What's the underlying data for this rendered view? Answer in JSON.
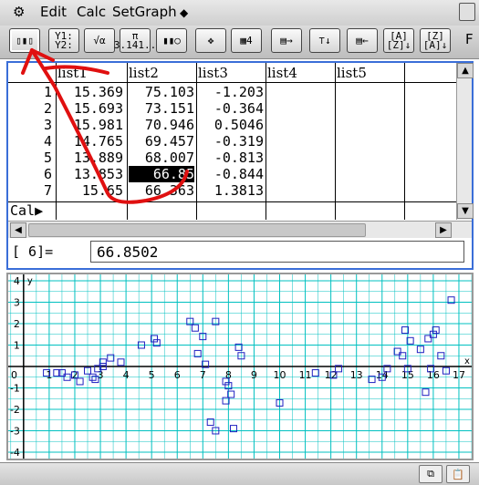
{
  "menubar": {
    "gear_icon": "gear-icon",
    "items": [
      "Edit",
      "Calc",
      "SetGraph"
    ],
    "dropdown_glyph": "◆"
  },
  "toolbar": {
    "buttons": [
      {
        "icon": "stat-graph-icon",
        "glyph": "▯▮▯"
      },
      {
        "icon": "graph-functions-icon",
        "glyph": "Y1:\nY2:"
      },
      {
        "icon": "sqrt-alpha-icon",
        "glyph": "√α"
      },
      {
        "icon": "pi-icon",
        "glyph": "π\n3.141.."
      },
      {
        "icon": "bar-chart-settings-icon",
        "glyph": "▮▮○"
      },
      {
        "icon": "zoom-arrows-icon",
        "glyph": "✥"
      },
      {
        "icon": "list-editor-icon",
        "glyph": "▦4"
      },
      {
        "icon": "insert-column-icon",
        "glyph": "▤→"
      },
      {
        "icon": "sort-icon",
        "glyph": "⊤↓"
      },
      {
        "icon": "delete-column-icon",
        "glyph": "▤←"
      },
      {
        "icon": "sort-ascending-icon",
        "glyph": "[A]\n[Z]↓"
      },
      {
        "icon": "sort-descending-icon",
        "glyph": "[Z]\n[A]↓"
      }
    ],
    "overflow_label": "F"
  },
  "list_editor": {
    "columns": [
      "list1",
      "list2",
      "list3",
      "list4",
      "list5"
    ],
    "rows": [
      {
        "n": "1",
        "list1": "15.369",
        "list2": "75.103",
        "list3": "-1.203"
      },
      {
        "n": "2",
        "list1": "15.693",
        "list2": "73.151",
        "list3": "-0.364"
      },
      {
        "n": "3",
        "list1": "15.981",
        "list2": "70.946",
        "list3": "0.5046"
      },
      {
        "n": "4",
        "list1": "14.765",
        "list2": "69.457",
        "list3": "-0.319"
      },
      {
        "n": "5",
        "list1": "13.889",
        "list2": "68.007",
        "list3": "-0.813"
      },
      {
        "n": "6",
        "list1": "13.853",
        "list2": "66.85",
        "list3": "-0.844"
      },
      {
        "n": "7",
        "list1": "15.65",
        "list2": "66.363",
        "list3": "1.3813"
      }
    ],
    "cal_label": "Cal▶",
    "selected_row": 6,
    "selected_column": "list2"
  },
  "edit_line": {
    "label": "[  6]=",
    "value": "66.8502"
  },
  "graph": {
    "y_axis_label": "y",
    "x_axis_label": "x",
    "origin_label": "0",
    "x_ticks": [
      "1",
      "2",
      "3",
      "4",
      "5",
      "6",
      "7",
      "8",
      "9",
      "10",
      "11",
      "12",
      "13",
      "14",
      "15",
      "16",
      "17"
    ],
    "y_ticks": [
      "4",
      "3",
      "2",
      "1",
      "-1",
      "-2",
      "-3",
      "-4"
    ],
    "grid_color": "#00c0c0",
    "point_color": "#2020c0"
  },
  "chart_data": {
    "type": "scatter",
    "xlim": [
      -0.6,
      17.5
    ],
    "ylim": [
      -4.3,
      4.3
    ],
    "points": [
      [
        0.9,
        -0.3
      ],
      [
        1.3,
        -0.3
      ],
      [
        1.7,
        -0.5
      ],
      [
        2.0,
        -0.4
      ],
      [
        2.2,
        -0.7
      ],
      [
        1.5,
        -0.3
      ],
      [
        2.5,
        -0.2
      ],
      [
        2.7,
        -0.5
      ],
      [
        2.8,
        -0.6
      ],
      [
        2.9,
        -0.1
      ],
      [
        3.1,
        0.2
      ],
      [
        3.1,
        -0.0
      ],
      [
        3.4,
        0.4
      ],
      [
        3.8,
        0.2
      ],
      [
        4.6,
        1.0
      ],
      [
        5.1,
        1.3
      ],
      [
        5.2,
        1.1
      ],
      [
        6.5,
        2.1
      ],
      [
        6.7,
        1.8
      ],
      [
        6.8,
        0.6
      ],
      [
        7.0,
        1.4
      ],
      [
        7.1,
        0.1
      ],
      [
        7.5,
        2.1
      ],
      [
        7.9,
        -0.7
      ],
      [
        8.0,
        -0.9
      ],
      [
        8.1,
        -1.3
      ],
      [
        7.9,
        -1.6
      ],
      [
        7.3,
        -2.6
      ],
      [
        7.5,
        -3.0
      ],
      [
        8.2,
        -2.9
      ],
      [
        8.4,
        0.9
      ],
      [
        8.5,
        0.5
      ],
      [
        10.0,
        -1.7
      ],
      [
        11.4,
        -0.3
      ],
      [
        12.1,
        -0.4
      ],
      [
        12.3,
        -0.1
      ],
      [
        13.6,
        -0.6
      ],
      [
        14.0,
        -0.5
      ],
      [
        14.2,
        -0.1
      ],
      [
        14.6,
        0.7
      ],
      [
        14.8,
        0.5
      ],
      [
        14.9,
        1.7
      ],
      [
        15.0,
        -0.1
      ],
      [
        15.1,
        1.2
      ],
      [
        15.5,
        0.8
      ],
      [
        15.8,
        1.3
      ],
      [
        15.9,
        -0.1
      ],
      [
        16.1,
        1.7
      ],
      [
        16.0,
        1.5
      ],
      [
        16.3,
        0.5
      ],
      [
        16.5,
        -0.2
      ],
      [
        16.7,
        3.1
      ],
      [
        15.7,
        -1.2
      ]
    ]
  },
  "statusbar": {
    "left_icon": "copy-icon",
    "right_icon": "paste-icon"
  }
}
